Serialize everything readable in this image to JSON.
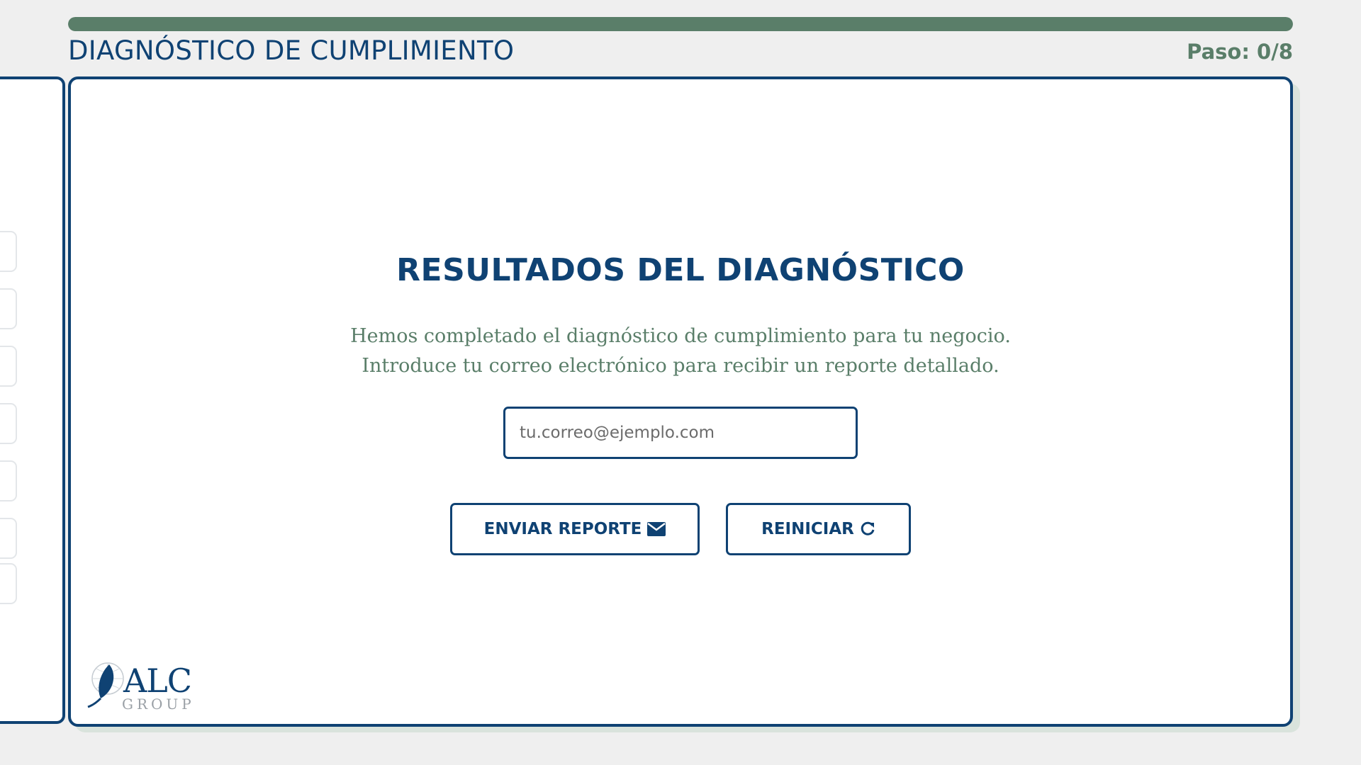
{
  "progress": {
    "fraction": 1.0,
    "color": "#5a7e69"
  },
  "header": {
    "title": "DIAGNÓSTICO DE CUMPLIMIENTO",
    "step": "Paso: 0/8"
  },
  "results": {
    "title": "RESULTADOS DEL DIAGNÓSTICO",
    "description_line1": "Hemos completado el diagnóstico de cumplimiento para tu negocio.",
    "description_line2": "Introduce tu correo electrónico para recibir un reporte detallado.",
    "email_placeholder": "tu.correo@ejemplo.com",
    "email_value": ""
  },
  "buttons": {
    "send_label": "ENVIAR REPORTE",
    "send_icon": "envelope-icon",
    "reset_label": "REINICIAR",
    "reset_icon": "refresh-icon"
  },
  "logo": {
    "name": "ALC",
    "sub": "GROUP"
  },
  "colors": {
    "primary": "#0f4273",
    "accent": "#5a7e69",
    "background": "#efefef"
  }
}
